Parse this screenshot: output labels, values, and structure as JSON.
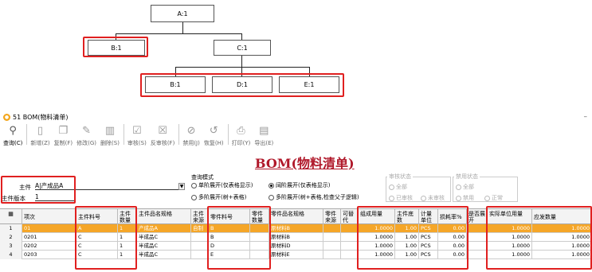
{
  "tree": {
    "root": "A:1",
    "level1": [
      "B:1",
      "C:1"
    ],
    "level2": [
      "B:1",
      "D:1",
      "E:1"
    ]
  },
  "window": {
    "title": "51 BOM(物料清单)",
    "minimize": "–"
  },
  "toolbar": [
    {
      "label": "查询(C)",
      "icon": "search-icon"
    },
    {
      "label": "新增(Z)",
      "icon": "new-doc-icon"
    },
    {
      "label": "复制(F)",
      "icon": "copy-icon"
    },
    {
      "label": "修改(G)",
      "icon": "edit-icon"
    },
    {
      "label": "删除(S)",
      "icon": "delete-icon"
    },
    {
      "label": "审核(S)",
      "icon": "approve-icon"
    },
    {
      "label": "反审核(F)",
      "icon": "unapprove-icon"
    },
    {
      "label": "禁用(J)",
      "icon": "disable-icon"
    },
    {
      "label": "恢复(H)",
      "icon": "restore-icon"
    },
    {
      "label": "打印(Y)",
      "icon": "print-icon"
    },
    {
      "label": "导出(E)",
      "icon": "export-icon"
    }
  ],
  "heading": "BOM(物料清单)",
  "form": {
    "main_item_label": "主件",
    "main_item_value": "A|产成品A",
    "version_label": "主件版本",
    "version_value": "1"
  },
  "query_mode": {
    "label": "查询模式",
    "options": [
      "单阶展开(仅表格显示)",
      "多阶展开(树+表格)",
      "阔阶展开(仅表格显示)",
      "多阶展开(树+表格,检查父子逻辑)"
    ],
    "selected": "阔阶展开(仅表格显示)"
  },
  "audit_status": {
    "label": "审核状态",
    "options": [
      "全部",
      "已审核",
      "未审核"
    ]
  },
  "disable_status": {
    "label": "禁用状态",
    "options": [
      "全部",
      "禁用",
      "正常"
    ]
  },
  "table": {
    "headers": [
      "项次",
      "主件料号",
      "主件数量",
      "主件品名规格",
      "主件来源",
      "零件料号",
      "零件数量",
      "零件品名规格",
      "零件来源",
      "可替代",
      "组成用量",
      "主件底数",
      "计量单位",
      "损耗率%",
      "是否展开",
      "实际单位用量",
      "应发数量"
    ],
    "rows": [
      [
        "1",
        "01",
        "A",
        "1",
        "产成品A",
        "自制",
        "B",
        "",
        "原材料B",
        "",
        "",
        "1.0000",
        "1.00",
        "PCS",
        "0.00",
        "",
        "1.0000",
        "1.0000"
      ],
      [
        "2",
        "0201",
        "C",
        "1",
        "半成品C",
        "",
        "B",
        "",
        "原材料B",
        "",
        "",
        "1.0000",
        "1.00",
        "PCS",
        "0.00",
        "",
        "1.0000",
        "1.0000"
      ],
      [
        "3",
        "0202",
        "C",
        "1",
        "半成品C",
        "",
        "D",
        "",
        "原材料D",
        "",
        "",
        "1.0000",
        "1.00",
        "PCS",
        "0.00",
        "",
        "1.0000",
        "1.0000"
      ],
      [
        "4",
        "0203",
        "C",
        "1",
        "半成品C",
        "",
        "E",
        "",
        "原材料E",
        "",
        "",
        "1.0000",
        "1.00",
        "PCS",
        "0.00",
        "",
        "1.0000",
        "1.0000"
      ]
    ]
  },
  "colors": {
    "highlight": "#e02020",
    "selected_row": "#f5a628",
    "heading": "#b0182a"
  }
}
